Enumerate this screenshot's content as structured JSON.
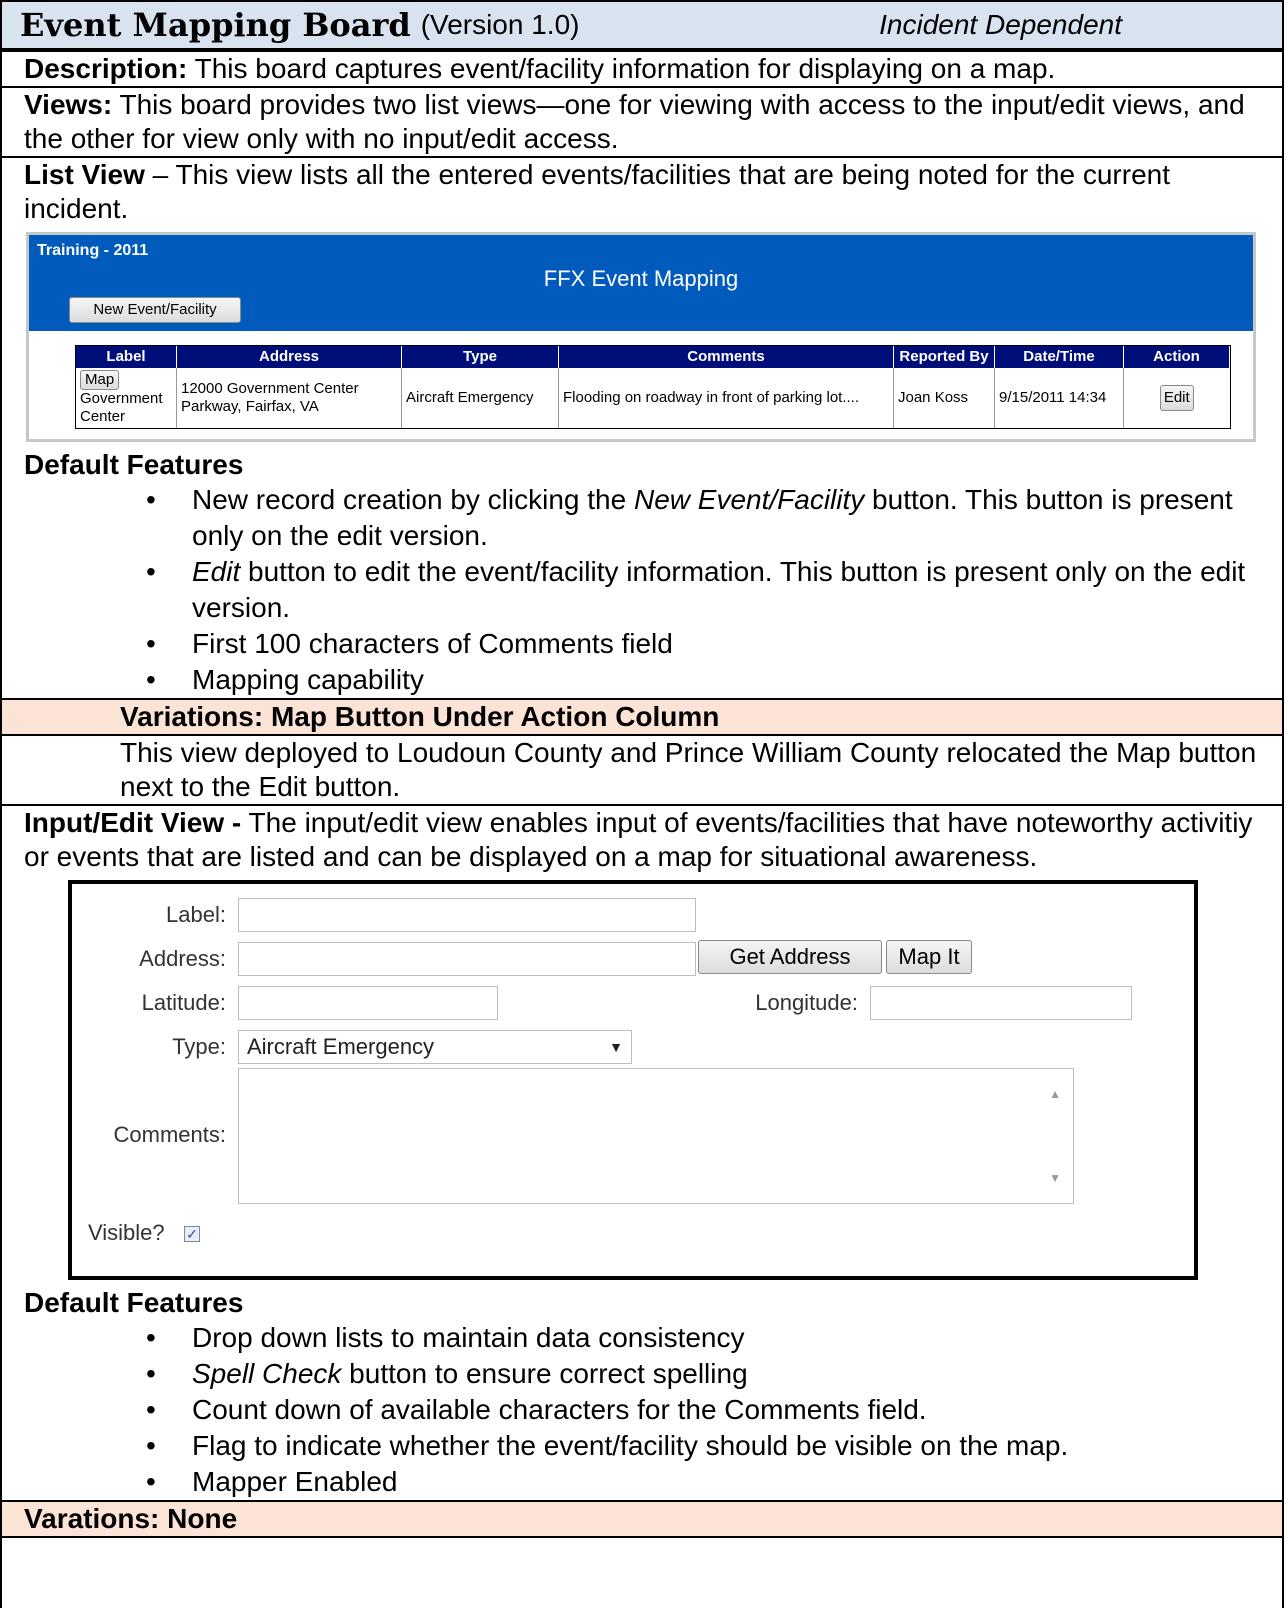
{
  "header": {
    "title": "Event Mapping Board",
    "version": "(Version 1.0)",
    "scope": "Incident Dependent"
  },
  "description": {
    "label": "Description:",
    "text": " This board captures event/facility information for displaying on a map."
  },
  "views": {
    "label": "Views:",
    "text": "  This board provides two list views—one for viewing with access to the input/edit views, and the other for view only with no input/edit access."
  },
  "list_view": {
    "label": "List View",
    "text": " – This view lists all the entered events/facilities that are being noted for the current incident.",
    "screenshot": {
      "org": "Training - 2011",
      "app_title": "FFX Event Mapping",
      "new_button": "New Event/Facility",
      "columns": [
        "Label",
        "Address",
        "Type",
        "Comments",
        "Reported By",
        "Date/Time",
        "Action"
      ],
      "row": {
        "map_button": "Map",
        "label": "Government Center",
        "address": "12000 Government Center Parkway, Fairfax, VA",
        "type": "Aircraft Emergency",
        "comments": "Flooding on roadway in front of parking lot....",
        "reported_by": "Joan Koss",
        "datetime": "9/15/2011 14:34",
        "edit_button": "Edit"
      }
    },
    "features_heading": "Default Features",
    "features": [
      {
        "pre": "New record creation by clicking the ",
        "em": "New Event/Facility",
        "post": " button.  This button is present only on the edit version."
      },
      {
        "pre": "",
        "em": "Edit",
        "post": " button to edit the event/facility information.  This button is present only on the edit version."
      },
      {
        "pre": "First 100 characters of Comments field",
        "em": "",
        "post": ""
      },
      {
        "pre": "Mapping capability",
        "em": "",
        "post": ""
      }
    ]
  },
  "variation1": {
    "heading": "Variations:  Map Button Under Action Column",
    "text": "This view deployed to Loudoun County and Prince William County relocated the Map button next to the Edit button."
  },
  "input_view": {
    "label": "Input/Edit View -",
    "text": "  The input/edit view enables input of events/facilities that have noteworthy activitiy or events that are listed and can be displayed on a map for situational awareness.",
    "form": {
      "label_label": "Label:",
      "address_label": "Address:",
      "get_address": "Get Address",
      "map_it": "Map It",
      "latitude_label": "Latitude:",
      "longitude_label": "Longitude:",
      "type_label": "Type:",
      "type_value": "Aircraft Emergency",
      "comments_label": "Comments:",
      "visible_label": "Visible?"
    },
    "features_heading": "Default Features",
    "features": [
      {
        "pre": "Drop down lists to maintain data consistency",
        "em": "",
        "post": ""
      },
      {
        "pre": "",
        "em": "Spell Check",
        "post": " button to ensure correct spelling"
      },
      {
        "pre": "Count down of available characters for the Comments field.",
        "em": "",
        "post": ""
      },
      {
        "pre": "Flag to indicate whether the event/facility should be visible on the map.",
        "em": "",
        "post": ""
      },
      {
        "pre": "Mapper Enabled",
        "em": "",
        "post": ""
      }
    ]
  },
  "variation2": {
    "heading": "Varations: None"
  }
}
